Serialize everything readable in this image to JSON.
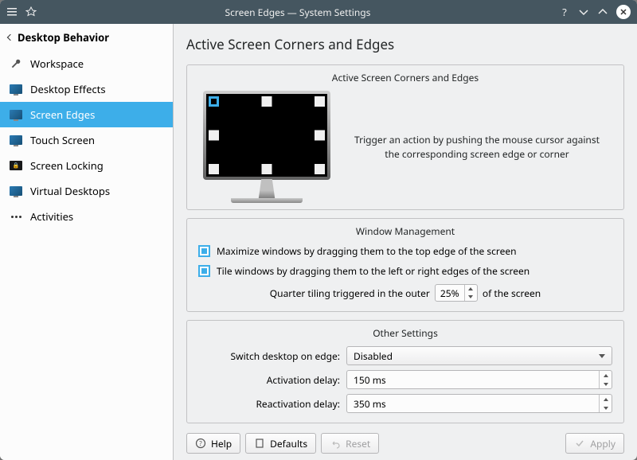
{
  "titlebar": {
    "title": "Screen Edges — System Settings"
  },
  "sidebar": {
    "header": "Desktop Behavior",
    "items": [
      {
        "label": "Workspace"
      },
      {
        "label": "Desktop Effects"
      },
      {
        "label": "Screen Edges"
      },
      {
        "label": "Touch Screen"
      },
      {
        "label": "Screen Locking"
      },
      {
        "label": "Virtual Desktops"
      },
      {
        "label": "Activities"
      }
    ],
    "selected_index": 2
  },
  "main": {
    "title": "Active Screen Corners and Edges",
    "panel1": {
      "title": "Active Screen Corners and Edges",
      "hint": "Trigger an action by pushing the mouse cursor against the corresponding screen edge or corner"
    },
    "wm": {
      "title": "Window Management",
      "maximize_label": "Maximize windows by dragging them to the top edge of the screen",
      "maximize_checked": true,
      "tile_label": "Tile windows by dragging them to the left or right edges of the screen",
      "tile_checked": true,
      "quarter_prefix": "Quarter tiling triggered in the outer",
      "quarter_value": "25%",
      "quarter_suffix": "of the screen"
    },
    "other": {
      "title": "Other Settings",
      "switch_label": "Switch desktop on edge:",
      "switch_value": "Disabled",
      "activation_label": "Activation delay:",
      "activation_value": "150 ms",
      "reactivation_label": "Reactivation delay:",
      "reactivation_value": "350 ms"
    }
  },
  "footer": {
    "help": "Help",
    "defaults": "Defaults",
    "reset": "Reset",
    "apply": "Apply"
  }
}
